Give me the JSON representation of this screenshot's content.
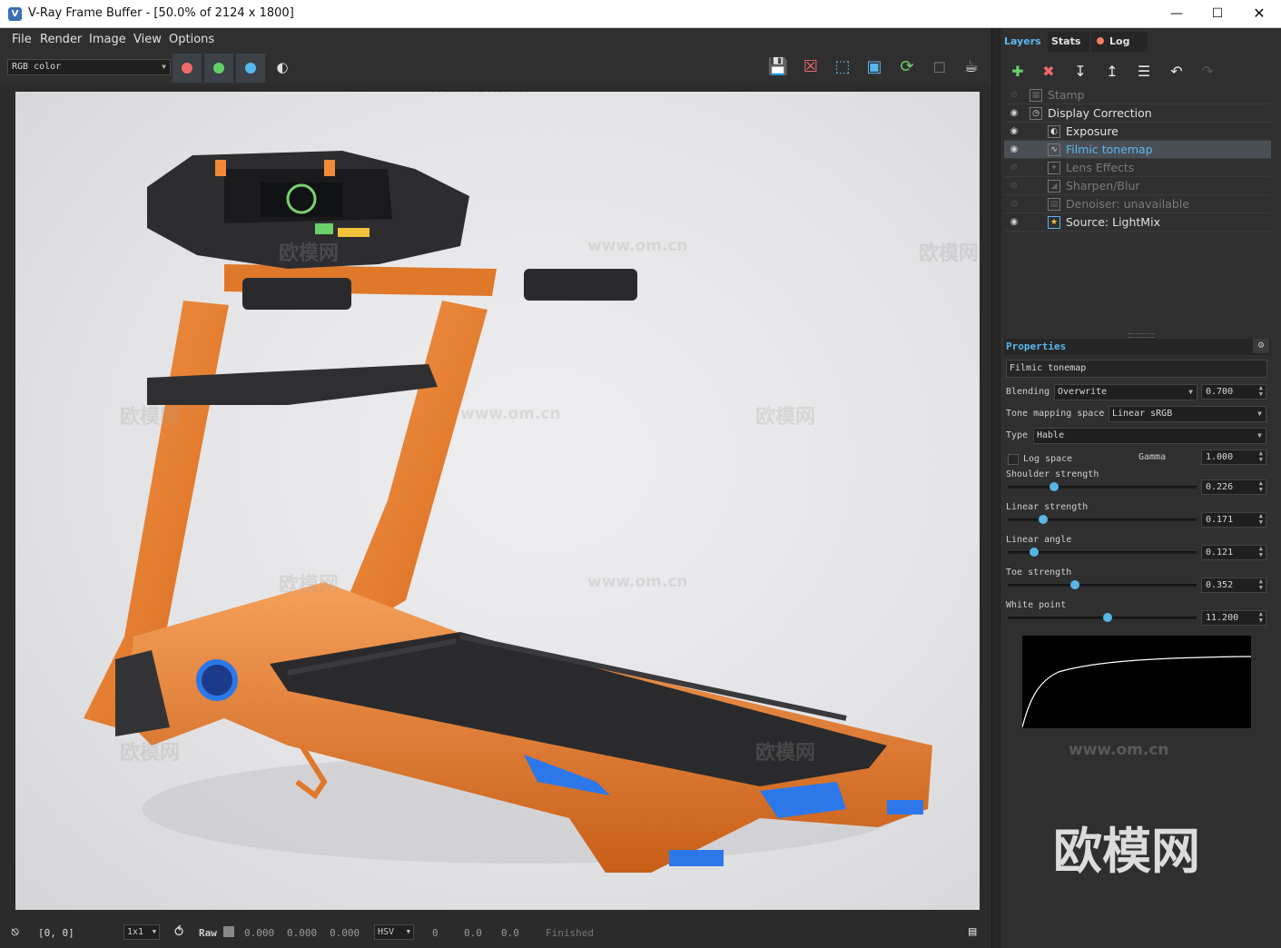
{
  "window": {
    "title": "V-Ray Frame Buffer - [50.0% of 2124 x 1800]"
  },
  "menu": [
    "File",
    "Render",
    "Image",
    "View",
    "Options"
  ],
  "toolbar": {
    "channel": "RGB color",
    "channel_buttons": [
      {
        "name": "red-channel",
        "color": "#f06a6a"
      },
      {
        "name": "green-channel",
        "color": "#5fd06a"
      },
      {
        "name": "blue-channel",
        "color": "#5ab8f0"
      }
    ]
  },
  "status": {
    "coords": "[0, 0]",
    "zoom": "1x1",
    "raw_label": "Raw",
    "raw_values": [
      "0.000",
      "0.000",
      "0.000"
    ],
    "color_space": "HSV",
    "hsv_values": [
      "0",
      "0.0",
      "0.0"
    ],
    "state": "Finished"
  },
  "tabs": [
    {
      "label": "Layers",
      "color": "#5ab8f0"
    },
    {
      "label": "Stats",
      "color": "#e0e0e0"
    },
    {
      "label": "Log",
      "color": "#e0e0e0",
      "dot": "#f08060"
    }
  ],
  "layers": [
    {
      "name": "Stamp",
      "visible": false,
      "level": 0
    },
    {
      "name": "Display Correction",
      "visible": true,
      "level": 0
    },
    {
      "name": "Exposure",
      "visible": true,
      "level": 1
    },
    {
      "name": "Filmic tonemap",
      "visible": true,
      "level": 1,
      "selected": true
    },
    {
      "name": "Lens Effects",
      "visible": false,
      "level": 1
    },
    {
      "name": "Sharpen/Blur",
      "visible": false,
      "level": 1
    },
    {
      "name": "Denoiser: unavailable",
      "visible": false,
      "level": 1
    },
    {
      "name": "Source: LightMix",
      "visible": true,
      "level": 1
    }
  ],
  "properties": {
    "header": "Properties",
    "layer_name": "Filmic tonemap",
    "blending_label": "Blending",
    "blending": "Overwrite",
    "blending_amount": "0.700",
    "tone_space_label": "Tone mapping space",
    "tone_space": "Linear sRGB",
    "type_label": "Type",
    "type": "Hable",
    "log_space_label": "Log space",
    "gamma_label": "Gamma",
    "gamma": "1.000",
    "sliders": [
      {
        "label": "Shoulder strength",
        "value": "0.226",
        "fraction": 0.23
      },
      {
        "label": "Linear strength",
        "value": "0.171",
        "fraction": 0.17
      },
      {
        "label": "Linear angle",
        "value": "0.121",
        "fraction": 0.12
      },
      {
        "label": "Toe strength",
        "value": "0.352",
        "fraction": 0.35
      },
      {
        "label": "White point",
        "value": "11.200",
        "fraction": 0.53
      }
    ]
  },
  "watermarks": {
    "url": "www.om.cn",
    "cn": "欧模网"
  }
}
